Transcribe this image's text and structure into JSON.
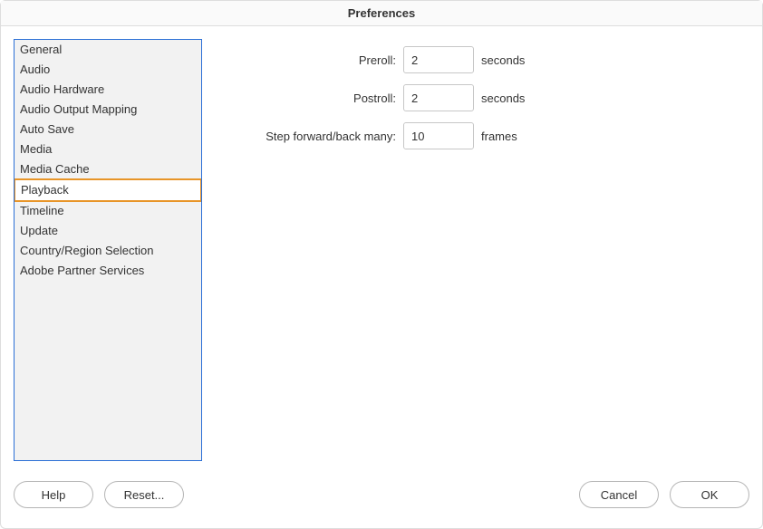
{
  "title": "Preferences",
  "sidebar": {
    "items": [
      {
        "label": "General"
      },
      {
        "label": "Audio"
      },
      {
        "label": "Audio Hardware"
      },
      {
        "label": "Audio Output Mapping"
      },
      {
        "label": "Auto Save"
      },
      {
        "label": "Media"
      },
      {
        "label": "Media Cache"
      },
      {
        "label": "Playback"
      },
      {
        "label": "Timeline"
      },
      {
        "label": "Update"
      },
      {
        "label": "Country/Region Selection"
      },
      {
        "label": "Adobe Partner Services"
      }
    ],
    "selectedIndex": 7
  },
  "fields": {
    "preroll": {
      "label": "Preroll:",
      "value": "2",
      "unit": "seconds"
    },
    "postroll": {
      "label": "Postroll:",
      "value": "2",
      "unit": "seconds"
    },
    "step": {
      "label": "Step forward/back many:",
      "value": "10",
      "unit": "frames"
    }
  },
  "buttons": {
    "help": "Help",
    "reset": "Reset...",
    "cancel": "Cancel",
    "ok": "OK"
  }
}
